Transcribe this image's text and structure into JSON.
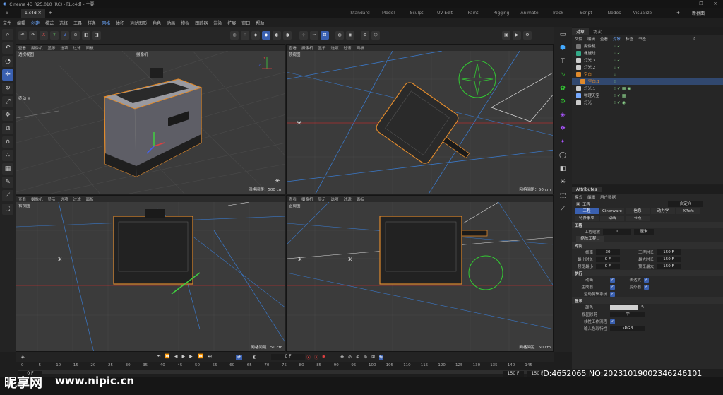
{
  "window": {
    "title": "Cinema 4D R25.010 (RC) - [1.c4d] - 主要",
    "doc_tab": "1.c4d",
    "add_tab": "+",
    "min": "—",
    "max": "❐",
    "close": "✕"
  },
  "layouts": [
    "Standard",
    "Model",
    "Sculpt",
    "UV Edit",
    "Paint",
    "Rigging",
    "Animate",
    "Track",
    "Script",
    "Nodes",
    "Visualize"
  ],
  "layout_add": "+",
  "layout_current": "新界面",
  "menu": [
    "文件",
    "编辑",
    "创建",
    "模式",
    "选择",
    "工具",
    "样条",
    "网格",
    "体积",
    "运动图形",
    "角色",
    "动画",
    "模拟",
    "跟踪器",
    "渲染",
    "扩展",
    "窗口",
    "帮助"
  ],
  "menu_highlight": [
    2,
    7
  ],
  "toolbar": {
    "axes": [
      "X",
      "Y",
      "Z"
    ]
  },
  "viewports": [
    {
      "name": "透视视图",
      "menus": [
        "查看",
        "摄像机",
        "显示",
        "选项",
        "过滤",
        "面板"
      ],
      "grid": "网格间距：500 cm",
      "camera": "摄像机",
      "move": "移动 ✛"
    },
    {
      "name": "顶视图",
      "menus": [
        "查看",
        "摄像机",
        "显示",
        "选项",
        "过滤",
        "面板"
      ],
      "grid": "网格间距：50 cm"
    },
    {
      "name": "右视图",
      "menus": [
        "查看",
        "摄像机",
        "显示",
        "选项",
        "过滤",
        "面板"
      ],
      "grid": "网格间距：50 cm"
    },
    {
      "name": "正视图",
      "menus": [
        "查看",
        "摄像机",
        "显示",
        "选项",
        "过滤",
        "面板"
      ],
      "grid": "网格间距：50 cm"
    }
  ],
  "objects_panel": {
    "tabs": [
      "对象",
      "场次"
    ],
    "menu": [
      "文件",
      "编辑",
      "查看",
      "对象",
      "标签",
      "书签"
    ],
    "items": [
      "摄像机",
      "螺旋线",
      "灯光.3",
      "灯光.2",
      "空白",
      "空白.1",
      "灯光.1",
      "物理天空",
      "灯光"
    ]
  },
  "attributes": {
    "tab": "Attributes",
    "menu": [
      "模式",
      "编辑",
      "用户数据"
    ],
    "title": "工程",
    "preset": "自定义",
    "tabs": [
      "工程",
      "Cinerware",
      "信息",
      "动力学",
      "XRefs"
    ],
    "subtabs": [
      "待办事项",
      "动画",
      "节点"
    ],
    "section_project": "工程",
    "scale_label": "工程缩放",
    "scale_value": "1",
    "scale_unit": "厘米",
    "scale_btn": "缩放工程...",
    "section_time": "时间",
    "fps_label": "帧率",
    "fps": "30",
    "len_label": "工程时长",
    "len": "150 F",
    "min_label": "最小时长",
    "min": "0 F",
    "max_label": "最大时长",
    "max": "150 F",
    "pmin_label": "预览最小",
    "pmin": "0 F",
    "pmax_label": "预览最大",
    "pmax": "150 F",
    "section_exec": "执行",
    "exec": [
      "动画",
      "表达式",
      "生成器",
      "变形器",
      "运动剪辑系统"
    ],
    "section_display": "显示",
    "color_label": "颜色",
    "lod_label": "视图修剪",
    "lod": "中",
    "lw_label": "线性工作流程",
    "cs_label": "输入色彩特性",
    "cs": "sRGB"
  },
  "playback": {
    "frame": "0 F",
    "start": "0 F",
    "end": "150 F",
    "end2": "150 F"
  },
  "ticks": [
    "0",
    "5",
    "10",
    "15",
    "20",
    "25",
    "30",
    "35",
    "40",
    "45",
    "50",
    "55",
    "60",
    "65",
    "70",
    "75",
    "80",
    "85",
    "90",
    "95",
    "100",
    "105",
    "110",
    "115",
    "120",
    "125",
    "130",
    "135",
    "140",
    "145"
  ],
  "watermark": {
    "site": "昵享网",
    "url": "www.nipic.cn",
    "id": "ID:4652065 NO:20231019002346246101"
  },
  "colors": {
    "accent": "#3a60b0",
    "selection_outline": "#e08a2c",
    "x_axis": "#e04040",
    "y_axis": "#40d040",
    "z_axis": "#4060ff"
  }
}
